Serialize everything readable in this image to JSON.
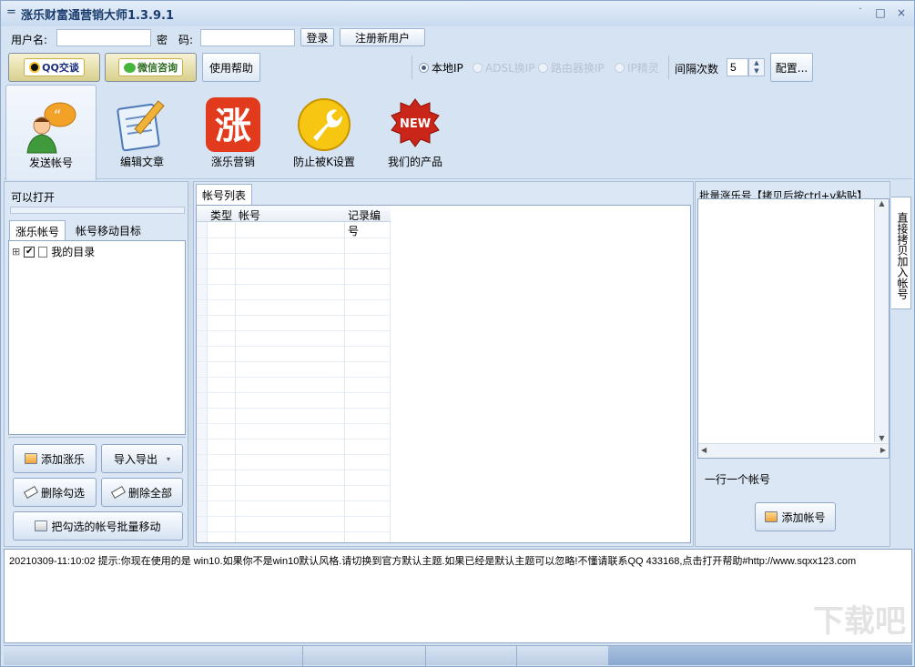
{
  "window": {
    "title": "涨乐财富通营销大师1.3.9.1",
    "sys_icon": "=",
    "controls": [
      "˙",
      "□",
      "×"
    ]
  },
  "login": {
    "username_label": "用户名:",
    "username_value": "",
    "password_label": "密　码:",
    "password_value": "",
    "login_button": "登录",
    "register_button": "注册新用户"
  },
  "toolbar": {
    "qq_button": "QQ交谈",
    "wechat_button": "微信咨询",
    "help_button": "使用帮助",
    "ip_options": [
      {
        "label": "本地IP",
        "selected": true,
        "enabled": true
      },
      {
        "label": "ADSL换IP",
        "selected": false,
        "enabled": false
      },
      {
        "label": "路由器换IP",
        "selected": false,
        "enabled": false
      },
      {
        "label": "IP精灵",
        "selected": false,
        "enabled": false
      }
    ],
    "interval_label": "间隔次数",
    "interval_value": "5",
    "config_button": "配置..."
  },
  "ribbon": {
    "tabs": [
      {
        "label": "发送帐号",
        "icon": "user-chat-icon",
        "active": true
      },
      {
        "label": "编辑文章",
        "icon": "edit-article-icon",
        "active": false
      },
      {
        "label": "涨乐营销",
        "icon": "zhangle-logo-icon",
        "active": false,
        "glyph": "涨"
      },
      {
        "label": "防止被K设置",
        "icon": "wrench-icon",
        "active": false
      },
      {
        "label": "我们的产品",
        "icon": "new-badge-icon",
        "active": false,
        "glyph": "NEW"
      }
    ]
  },
  "left_panel": {
    "header": "可以打开",
    "tabs": [
      "涨乐帐号",
      "帐号移动目标"
    ],
    "tree": [
      {
        "label": "我的目录",
        "checked": true,
        "expander": "⊞"
      }
    ],
    "buttons": {
      "add": "添加涨乐",
      "import_export": "导入导出",
      "delete_checked": "删除勾选",
      "delete_all": "删除全部",
      "batch_move": "把勾选的帐号批量移动"
    }
  },
  "center_panel": {
    "tab": "帐号列表",
    "columns": [
      "类型",
      "帐号",
      "记录编号"
    ],
    "rows": []
  },
  "right_panel": {
    "header": "批量涨乐号【拷贝后按ctrl+v粘贴】",
    "textarea_value": "",
    "hint": "一行一个帐号",
    "add_button": "添加帐号",
    "side_tab": "直接拷贝加入帐号"
  },
  "log": {
    "lines": [
      "20210309-11:10:02  提示:你现在使用的是 win10.如果你不是win10默认风格.请切换到官方默认主题.如果已经是默认主题可以忽略!不懂请联系QQ 433168,点击打开帮助#http://www.sqxx123.com"
    ]
  },
  "watermark": "下载吧",
  "colors": {
    "accent": "#1b3d6e",
    "panel": "#dbe7f4",
    "border": "#8fa6c6"
  }
}
